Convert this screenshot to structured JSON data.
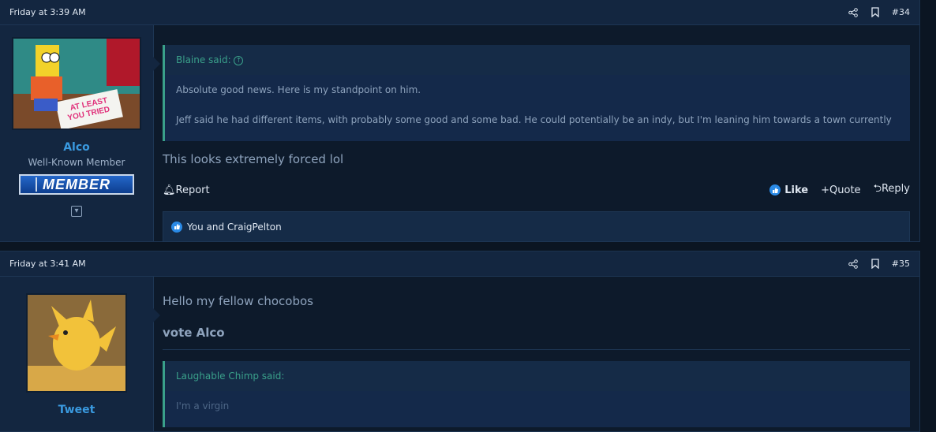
{
  "posts": [
    {
      "date": "Friday at 3:39 AM",
      "number": "#34",
      "user": {
        "name": "Alco",
        "title": "Well-Known Member",
        "banner": "MEMBER",
        "avatar_text": "AT LEAST YOU TRIED"
      },
      "quote": {
        "author": "Blaine said:",
        "lines": [
          "Absolute good news. Here is my standpoint on him.",
          "Jeff said he had different items, with probably some good and some bad. He could potentially be an indy, but I'm leaning him towards a town currently"
        ]
      },
      "message": "This looks extremely forced lol",
      "actions": {
        "report": "Report",
        "like": "Like",
        "quote": "Quote",
        "reply": "Reply"
      },
      "reactions": "You and CraigPelton"
    },
    {
      "date": "Friday at 3:41 AM",
      "number": "#35",
      "user": {
        "name": "Tweet"
      },
      "message": "Hello my fellow chocobos",
      "vote": "vote Alco",
      "quote": {
        "author": "Laughable Chimp said:",
        "lines": [
          "I'm a virgin"
        ]
      }
    }
  ],
  "colors": {
    "accent": "#3a9ae0",
    "quote_bar": "#3aa08a",
    "like": "#2a8ae6"
  }
}
